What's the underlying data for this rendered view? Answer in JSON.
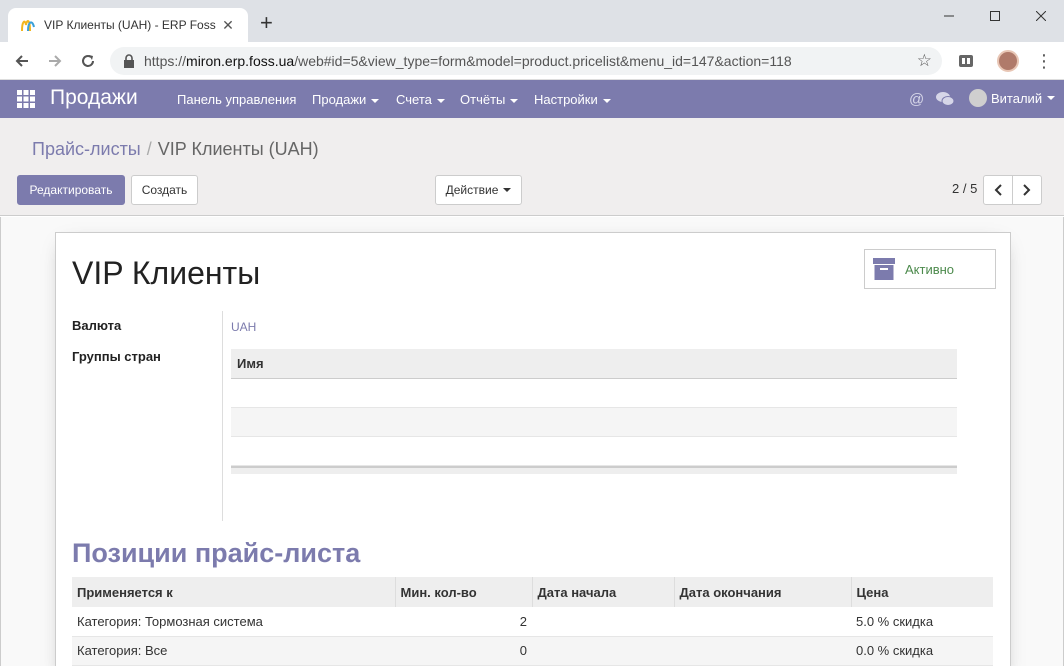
{
  "browser": {
    "tab_title": "VIP Клиенты (UAH) - ERP Foss",
    "url_scheme": "https://",
    "url_host": "miron.erp.foss.ua",
    "url_path": "/web#id=5&view_type=form&model=product.pricelist&menu_id=147&action=118"
  },
  "topnav": {
    "app_name": "Продажи",
    "menus": [
      "Панель управления",
      "Продажи",
      "Счета",
      "Отчёты",
      "Настройки"
    ],
    "user_name": "Виталий"
  },
  "breadcrumb": {
    "parent": "Прайс-листы",
    "current": "VIP Клиенты (UAH)"
  },
  "buttons": {
    "edit": "Редактировать",
    "create": "Создать",
    "action": "Действие"
  },
  "pager": {
    "value": "2 / 5"
  },
  "record": {
    "name": "VIP Клиенты",
    "status_button": "Активно",
    "currency_label": "Валюта",
    "currency_value": "UAH",
    "country_groups_label": "Группы стран",
    "country_groups_column": "Имя"
  },
  "pricelist_items": {
    "title": "Позиции прайс-листа",
    "columns": [
      "Применяется к",
      "Мин. кол-во",
      "Дата начала",
      "Дата окончания",
      "Цена"
    ],
    "rows": [
      {
        "applies_to": "Категория: Тормозная система",
        "min_qty": "2",
        "date_start": "",
        "date_end": "",
        "price": "5.0 % скидка"
      },
      {
        "applies_to": "Категория: Все",
        "min_qty": "0",
        "date_start": "",
        "date_end": "",
        "price": "0.0 % скидка"
      }
    ]
  },
  "colors": {
    "brand": "#7c7bad",
    "active_green": "#4c8a4c"
  }
}
